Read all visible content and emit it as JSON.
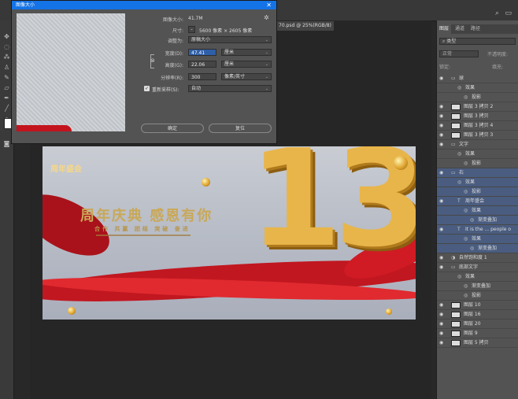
{
  "dialog": {
    "title": "图像大小",
    "image_size_label": "图像大小:",
    "image_size_value": "41.7M",
    "dimensions_label": "尺寸:",
    "dimensions_value": "5600 像素 × 2605 像素",
    "fit_to_label": "调整为:",
    "fit_to_value": "原稿大小",
    "width_label": "宽度(D):",
    "width_value": "47.41",
    "width_unit": "厘米",
    "height_label": "高度(G):",
    "height_value": "22.06",
    "height_unit": "厘米",
    "resolution_label": "分辨率(R):",
    "resolution_value": "300",
    "resolution_unit": "像素/英寸",
    "resample_label": "重新采样(S):",
    "resample_value": "自动",
    "ok_label": "确定",
    "cancel_label": "复位"
  },
  "document_tab": {
    "title": "70.psd @ 25%(RGB/8)",
    "close": "×"
  },
  "banner": {
    "anniversary": "周年盛会",
    "headline": "周年庆典 感恩有你",
    "subline": "合作 共赢 团结 突破 奋进",
    "number": "13"
  },
  "panel": {
    "tabs": [
      "图层",
      "通道",
      "路径"
    ],
    "filter_label": "类型",
    "blend_mode": "正常",
    "opacity_label": "不透明度:",
    "lock_label": "锁定:",
    "fill_label": "填充:",
    "layers": [
      {
        "name": "球",
        "kind": "group",
        "indent": 0
      },
      {
        "name": "效果",
        "kind": "fx",
        "indent": 1
      },
      {
        "name": "投影",
        "kind": "fx",
        "indent": 2
      },
      {
        "name": "图层 3 拷贝 2",
        "kind": "layer",
        "indent": 0
      },
      {
        "name": "图层 3 拷贝",
        "kind": "layer",
        "indent": 0
      },
      {
        "name": "图层 3 拷贝 4",
        "kind": "layer",
        "indent": 0
      },
      {
        "name": "图层 3 拷贝 3",
        "kind": "layer",
        "indent": 0
      },
      {
        "name": "文字",
        "kind": "group",
        "indent": 0
      },
      {
        "name": "效果",
        "kind": "fx",
        "indent": 1
      },
      {
        "name": "投影",
        "kind": "fx",
        "indent": 2
      },
      {
        "name": "右",
        "kind": "group",
        "indent": 0,
        "selected": true
      },
      {
        "name": "效果",
        "kind": "fx",
        "indent": 1,
        "selected": true
      },
      {
        "name": "投影",
        "kind": "fx",
        "indent": 2,
        "selected": true
      },
      {
        "name": "周年盛会",
        "kind": "text",
        "indent": 1,
        "selected": true
      },
      {
        "name": "效果",
        "kind": "fx",
        "indent": 2,
        "selected": true
      },
      {
        "name": "渐变叠加",
        "kind": "fx",
        "indent": 3,
        "selected": true
      },
      {
        "name": "It is the ... people o",
        "kind": "text",
        "indent": 1,
        "selected": true
      },
      {
        "name": "效果",
        "kind": "fx",
        "indent": 2,
        "selected": true
      },
      {
        "name": "渐变叠加",
        "kind": "fx",
        "indent": 3,
        "selected": true
      },
      {
        "name": "自然饱和度 1",
        "kind": "adjust",
        "indent": 0
      },
      {
        "name": "底部文字",
        "kind": "group",
        "indent": 0
      },
      {
        "name": "效果",
        "kind": "fx",
        "indent": 1
      },
      {
        "name": "渐变叠加",
        "kind": "fx",
        "indent": 2
      },
      {
        "name": "投影",
        "kind": "fx",
        "indent": 2
      },
      {
        "name": "图层 10",
        "kind": "layer",
        "indent": 0
      },
      {
        "name": "图层 16",
        "kind": "layer",
        "indent": 0
      },
      {
        "name": "图层 20",
        "kind": "layer",
        "indent": 0
      },
      {
        "name": "图层 9",
        "kind": "layer",
        "indent": 0
      },
      {
        "name": "图层 5 拷贝",
        "kind": "layer",
        "indent": 0
      }
    ]
  },
  "icons": {
    "eye": "eye-icon",
    "folder": "folder-icon",
    "text": "text-layer-icon",
    "fx": "effect-icon",
    "close": "close-icon",
    "gear": "gear-icon",
    "link": "link-icon"
  },
  "colors": {
    "accent": "#1473e6",
    "selected_layer": "#4a5d80",
    "ribbon_red": "#c11720",
    "gold": "#e8b54a"
  }
}
